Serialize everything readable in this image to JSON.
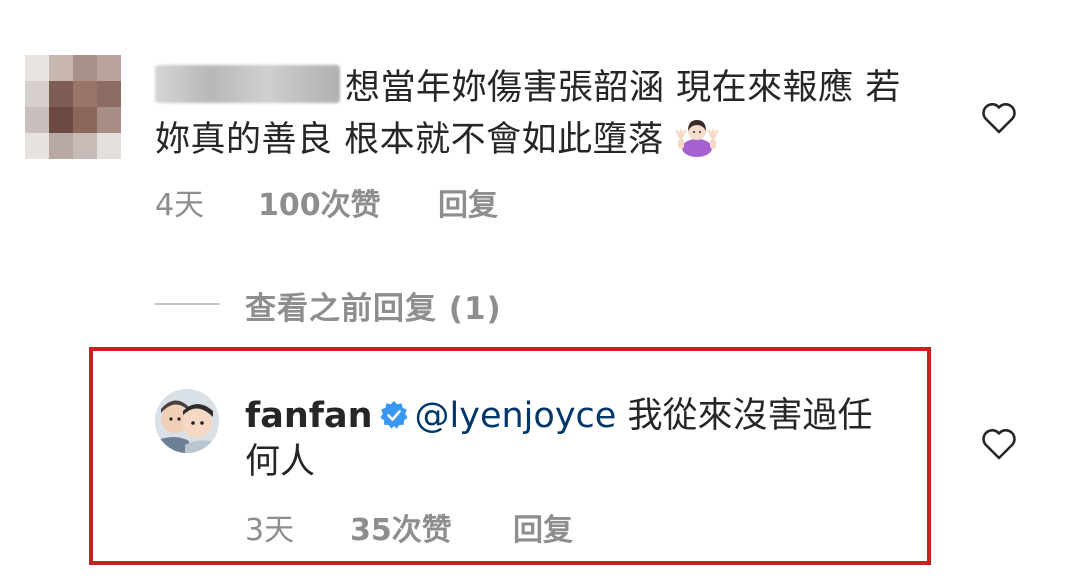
{
  "comment": {
    "text": "想當年妳傷害張韶涵 現在來報應 若妳真的善良 根本就不會如此墮落",
    "time": "4天",
    "likes": "100次赞",
    "reply_label": "回复"
  },
  "view_replies": "查看之前回复 (1)",
  "reply": {
    "username": "fanfan",
    "mention": "@lyenjoyce",
    "text": "我從來沒害過任何人",
    "time": "3天",
    "likes": "35次赞",
    "reply_label": "回复"
  },
  "colors": {
    "highlight_border": "#c8201f",
    "mention": "#00376b",
    "verified": "#3897f0",
    "meta_text": "#8e8e8e"
  },
  "icons": {
    "like": "heart-icon",
    "verified": "verified-badge-icon",
    "emoji": "shrug-emoji-icon"
  }
}
